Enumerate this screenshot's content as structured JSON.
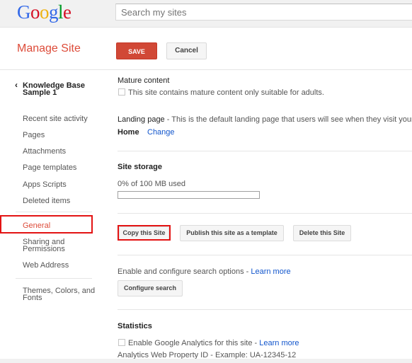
{
  "brand": {
    "logo_letters": [
      "G",
      "o",
      "o",
      "g",
      "l",
      "e"
    ],
    "logo_colors": [
      "#3369e8",
      "#d50f25",
      "#eeb211",
      "#3369e8",
      "#009925",
      "#d50f25"
    ]
  },
  "search": {
    "placeholder": "Search my sites"
  },
  "page": {
    "title": "Manage Site"
  },
  "toolbar": {
    "save_label": "SAVE",
    "cancel_label": "Cancel"
  },
  "sidebar": {
    "back_label": "Knowledge Base Sample 1",
    "items": [
      "Recent site activity",
      "Pages",
      "Attachments",
      "Page templates",
      "Apps Scripts",
      "Deleted items",
      "General",
      "Sharing and Permissions",
      "Web Address",
      "Themes, Colors, and Fonts"
    ],
    "active": "General"
  },
  "mature": {
    "title": "Mature content",
    "checkbox_label": "This site contains mature content only suitable for adults.",
    "checked": false
  },
  "landing": {
    "label": "Landing page",
    "description": " - This is the default landing page that users will see when they visit your site.",
    "value": "Home",
    "change_link": "Change"
  },
  "storage": {
    "title": "Site storage",
    "usage_text": "0% of 100 MB used",
    "used_fraction": 0
  },
  "actions": {
    "copy": "Copy this Site",
    "publish_template": "Publish this site as a template",
    "delete": "Delete this Site"
  },
  "search_options": {
    "text": "Enable and configure search options - ",
    "learn_more": "Learn more",
    "button": "Configure search"
  },
  "statistics": {
    "title": "Statistics",
    "checkbox_label": "Enable Google Analytics for this site - ",
    "learn_more": "Learn more",
    "checked": false,
    "property_id_label": "Analytics Web Property ID - Example: UA-12345-12"
  },
  "colors": {
    "accent": "#dd4b39",
    "save_bg": "#d14836",
    "link": "#1155cc",
    "highlight": "#e31313"
  }
}
